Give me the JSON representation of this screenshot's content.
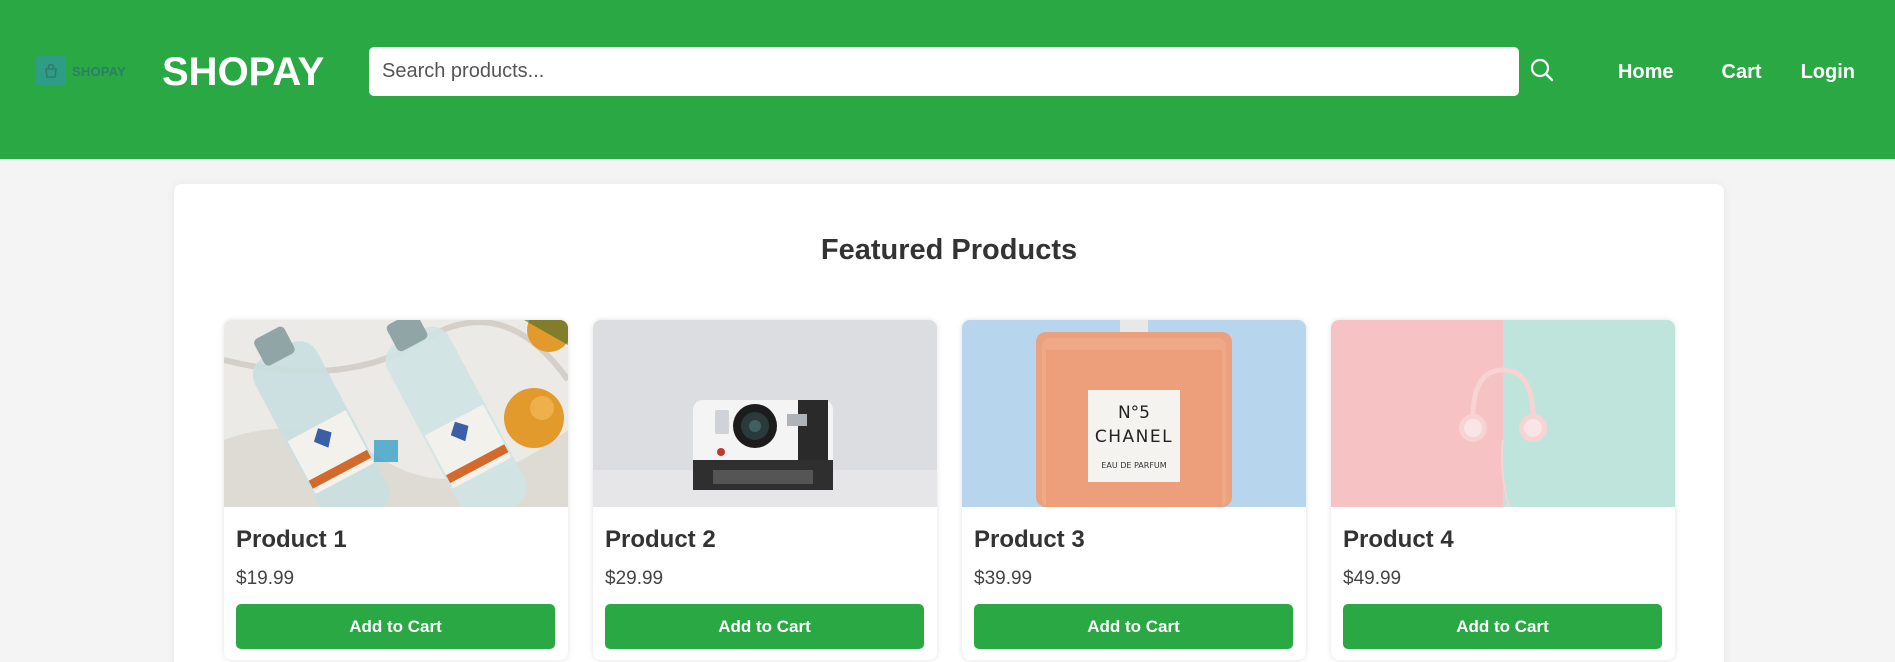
{
  "header": {
    "logo_text": "SHOPAY",
    "brand": "SHOPAY",
    "search": {
      "placeholder": "Search products...",
      "value": ""
    },
    "search_icon": "search-icon",
    "nav": [
      {
        "label": "Home"
      },
      {
        "label": "Cart"
      },
      {
        "label": "Login"
      }
    ],
    "colors": {
      "accent": "#29a844",
      "text": "#ffffff"
    }
  },
  "main": {
    "title": "Featured Products",
    "products": [
      {
        "name": "Product 1",
        "price": "$19.99",
        "button": "Add to Cart",
        "image": "mineral water bottles"
      },
      {
        "name": "Product 2",
        "price": "$29.99",
        "button": "Add to Cart",
        "image": "instant camera"
      },
      {
        "name": "Product 3",
        "price": "$39.99",
        "button": "Add to Cart",
        "image": "perfume bottle",
        "image_text": [
          "N°5",
          "CHANEL",
          "EAU DE PARFUM"
        ]
      },
      {
        "name": "Product 4",
        "price": "$49.99",
        "button": "Add to Cart",
        "image": "headphones on pastel background"
      }
    ]
  }
}
